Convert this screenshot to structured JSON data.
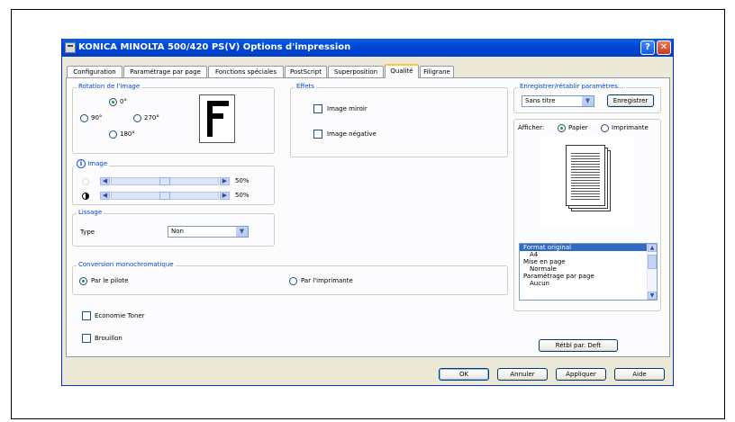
{
  "window": {
    "title": "KONICA MINOLTA 500/420 PS(V) Options d'impression",
    "help": "?",
    "close": "✕"
  },
  "tabs": [
    {
      "label": "Configuration"
    },
    {
      "label": "Paramétrage par page"
    },
    {
      "label": "Fonctions spéciales"
    },
    {
      "label": "PostScript"
    },
    {
      "label": "Superposition"
    },
    {
      "label": "Qualité",
      "active": true
    },
    {
      "label": "Filigrane"
    }
  ],
  "rotation": {
    "legend": "Rotation de l'image",
    "options": [
      "0°",
      "90°",
      "270°",
      "180°"
    ],
    "selected": "0°"
  },
  "effets": {
    "legend": "Effets",
    "mirror": "Image miroir",
    "negative": "Image négative"
  },
  "image": {
    "legend": "Image",
    "brightness_value": "50%",
    "contrast_value": "50%",
    "brightness_level": 0.5,
    "contrast_level": 0.5
  },
  "lissage": {
    "legend": "Lissage",
    "type_label": "Type",
    "type_value": "Non"
  },
  "conversion": {
    "legend": "Conversion monochromatique",
    "option_driver": "Par le pilote",
    "option_printer": "Par l'imprimante",
    "selected": "Par le pilote"
  },
  "checkboxes": {
    "economy": "Economie Toner",
    "draft": "Brouillon"
  },
  "settings": {
    "legend": "Enregistrer/rétablir paramètres...",
    "select_value": "Sans titre",
    "save_button": "Enregistrer"
  },
  "display": {
    "label": "Afficher:",
    "opt_paper": "Papier",
    "opt_printer": "Imprimante",
    "selected": "Papier"
  },
  "summary_list": [
    {
      "text": "Format original",
      "selected": true,
      "indent": false
    },
    {
      "text": "A4",
      "selected": false,
      "indent": true
    },
    {
      "text": "Mise en page",
      "selected": false,
      "indent": false
    },
    {
      "text": "Normale",
      "selected": false,
      "indent": true
    },
    {
      "text": "Paramétrage par page",
      "selected": false,
      "indent": false
    },
    {
      "text": "Aucun",
      "selected": false,
      "indent": true
    }
  ],
  "restore_button": "Rétbl par. Deft",
  "footer": {
    "ok": "OK",
    "cancel": "Annuler",
    "apply": "Appliquer",
    "help": "Aide"
  },
  "colors": {
    "title_bar": "#0054e3",
    "legend": "#0046d5",
    "selection": "#316ac5"
  }
}
